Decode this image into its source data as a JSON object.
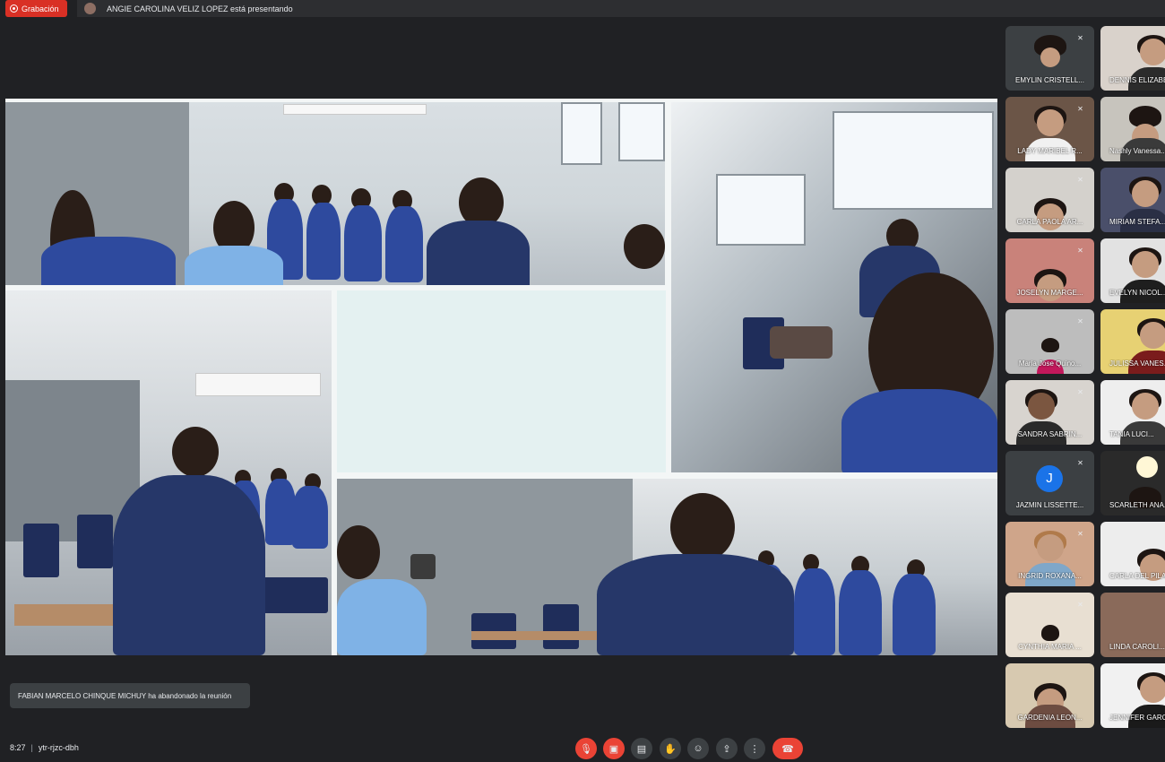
{
  "top_bar": {
    "recording_label": "Grabación",
    "presenting_text": "ANGIE CAROLINA VELIZ LOPEZ está presentando"
  },
  "participants": [
    {
      "name": "EMYLIN CRISTELL...",
      "muted": true,
      "avatar": "photo"
    },
    {
      "name": "DENNIS ELIZABE...",
      "muted": false,
      "avatar": "photo"
    },
    {
      "name": "LADY MARIBEL R...",
      "muted": true,
      "avatar": "photo"
    },
    {
      "name": "Nashly Vanessa...",
      "muted": false,
      "avatar": "photo"
    },
    {
      "name": "CARLA PAOLA AR...",
      "muted": true,
      "avatar": "photo"
    },
    {
      "name": "MIRIAM STEFA...",
      "muted": false,
      "avatar": "photo"
    },
    {
      "name": "JOSELYN MARGE...",
      "muted": true,
      "avatar": "photo"
    },
    {
      "name": "EVELYN NICOL...",
      "muted": false,
      "avatar": "photo"
    },
    {
      "name": "Maria Jose Quino...",
      "muted": true,
      "avatar": "photo"
    },
    {
      "name": "JULISSA VANES...",
      "muted": false,
      "avatar": "photo"
    },
    {
      "name": "SANDRA SABRIN...",
      "muted": true,
      "avatar": "photo"
    },
    {
      "name": "TANIA LUCI...",
      "muted": false,
      "avatar": "photo"
    },
    {
      "name": "JAZMIN LISSETTE...",
      "muted": true,
      "avatar": "letter",
      "initial": "J"
    },
    {
      "name": "SCARLETH ANA...",
      "muted": false,
      "avatar": "photo"
    },
    {
      "name": "INGRID ROXANA...",
      "muted": true,
      "avatar": "photo"
    },
    {
      "name": "CARLA DEL PILA...",
      "muted": false,
      "avatar": "photo"
    },
    {
      "name": "CYNTHIA MARIA ...",
      "muted": true,
      "avatar": "photo"
    },
    {
      "name": "LINDA CAROLI...",
      "muted": false,
      "avatar": "photo"
    },
    {
      "name": "GARDENIA LEON...",
      "muted": false,
      "avatar": "photo"
    },
    {
      "name": "JENNIFER GARC...",
      "muted": false,
      "avatar": "photo"
    }
  ],
  "notification": {
    "text": "FABIAN MARCELO CHINQUE MICHUY ha abandonado la reunión"
  },
  "bottom_bar": {
    "time": "8:27",
    "separator": "|",
    "meeting_code": "ytr-rjzc-dbh"
  },
  "controls": [
    {
      "name": "mic-off-button",
      "icon": "mic-off-icon",
      "glyph": "🎙",
      "style": "red"
    },
    {
      "name": "camera-off-button",
      "icon": "camera-off-icon",
      "glyph": "▣",
      "style": "red"
    },
    {
      "name": "captions-button",
      "icon": "captions-icon",
      "glyph": "▤",
      "style": "normal"
    },
    {
      "name": "raise-hand-button",
      "icon": "hand-icon",
      "glyph": "✋",
      "style": "normal"
    },
    {
      "name": "emoji-button",
      "icon": "emoji-icon",
      "glyph": "☺",
      "style": "normal"
    },
    {
      "name": "present-button",
      "icon": "present-icon",
      "glyph": "⇪",
      "style": "normal"
    },
    {
      "name": "more-options-button",
      "icon": "more-vert-icon",
      "glyph": "⋮",
      "style": "normal"
    },
    {
      "name": "hang-up-button",
      "icon": "hang-up-icon",
      "glyph": "☎",
      "style": "hangup"
    }
  ]
}
